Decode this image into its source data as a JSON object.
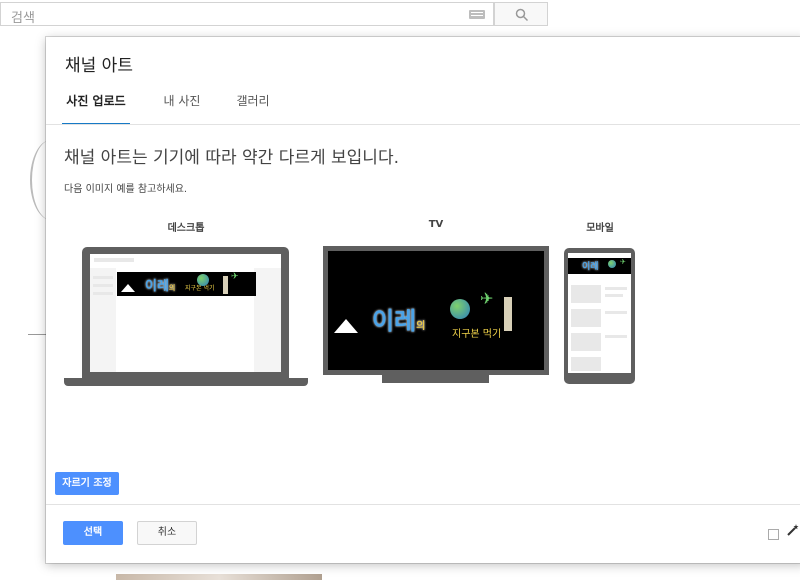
{
  "search": {
    "placeholder": "검색"
  },
  "dialog": {
    "title": "채널 아트",
    "tabs": [
      {
        "label": "사진 업로드",
        "active": true
      },
      {
        "label": "내 사진",
        "active": false
      },
      {
        "label": "갤러리",
        "active": false
      }
    ],
    "headline": "채널 아트는 기기에 따라 약간 다르게 보입니다.",
    "subtext": "다음 이미지 예를 참고하세요.",
    "devices": [
      {
        "label": "데스크톱",
        "icon": "laptop-icon"
      },
      {
        "label": "TV",
        "icon": "tv-icon"
      },
      {
        "label": "모바일",
        "icon": "phone-icon"
      }
    ],
    "art": {
      "title_a": "이레",
      "title_b": "의",
      "subtitle": "지구본 먹기"
    },
    "crop_button": "자르기 조정",
    "select_button": "선택",
    "cancel_button": "취소"
  },
  "colors": {
    "primary": "#4d90fe",
    "tab_underline": "#167ac6",
    "device_frame": "#5f5f5f"
  }
}
